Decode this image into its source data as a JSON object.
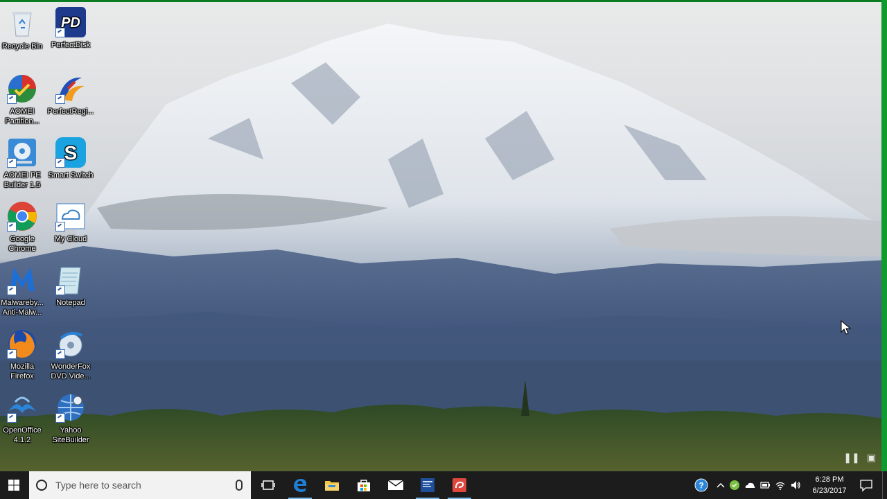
{
  "desktop": {
    "icons": [
      {
        "id": "recycle-bin",
        "label": "Recycle Bin",
        "icon": "recycle-bin-icon"
      },
      {
        "id": "perfectdisk",
        "label": "PerfectDisk",
        "icon": "perfectdisk-icon"
      },
      {
        "id": "aomei-partition",
        "label": "AOMEI Partition...",
        "icon": "aomei-partition-icon"
      },
      {
        "id": "perfectregistry",
        "label": "PerfectRegi...",
        "icon": "perfectregistry-icon"
      },
      {
        "id": "aomei-pe-builder",
        "label": "AOMEI PE Builder 1.5",
        "icon": "aomei-pe-builder-icon"
      },
      {
        "id": "smart-switch",
        "label": "Smart Switch",
        "icon": "smart-switch-icon"
      },
      {
        "id": "google-chrome",
        "label": "Google Chrome",
        "icon": "chrome-icon"
      },
      {
        "id": "my-cloud",
        "label": "My Cloud",
        "icon": "my-cloud-icon"
      },
      {
        "id": "malwarebytes",
        "label": "Malwareby... Anti-Malw...",
        "icon": "malwarebytes-icon"
      },
      {
        "id": "notepad",
        "label": "Notepad",
        "icon": "notepad-icon"
      },
      {
        "id": "firefox",
        "label": "Mozilla Firefox",
        "icon": "firefox-icon"
      },
      {
        "id": "wonderfox",
        "label": "WonderFox DVD Vide...",
        "icon": "wonderfox-icon"
      },
      {
        "id": "openoffice",
        "label": "OpenOffice 4.1.2",
        "icon": "openoffice-icon"
      },
      {
        "id": "yahoo-sitebuilder",
        "label": "Yahoo SiteBuilder",
        "icon": "yahoo-sitebuilder-icon"
      }
    ]
  },
  "taskbar": {
    "search_placeholder": "Type here to search",
    "pinned": [
      {
        "name": "task-view",
        "icon": "task-view-icon"
      },
      {
        "name": "edge",
        "icon": "edge-icon"
      },
      {
        "name": "file-explorer",
        "icon": "folder-icon"
      },
      {
        "name": "store",
        "icon": "store-icon"
      },
      {
        "name": "mail",
        "icon": "mail-icon"
      },
      {
        "name": "news-app",
        "icon": "news-icon"
      },
      {
        "name": "snagit",
        "icon": "snagit-icon"
      }
    ],
    "clock": {
      "time": "6:28 PM",
      "date": "6/23/2017"
    }
  },
  "colors": {
    "accent": "#0f9b2d",
    "taskbar": "#1c1c1c",
    "edge_blue": "#1e7fd6"
  }
}
